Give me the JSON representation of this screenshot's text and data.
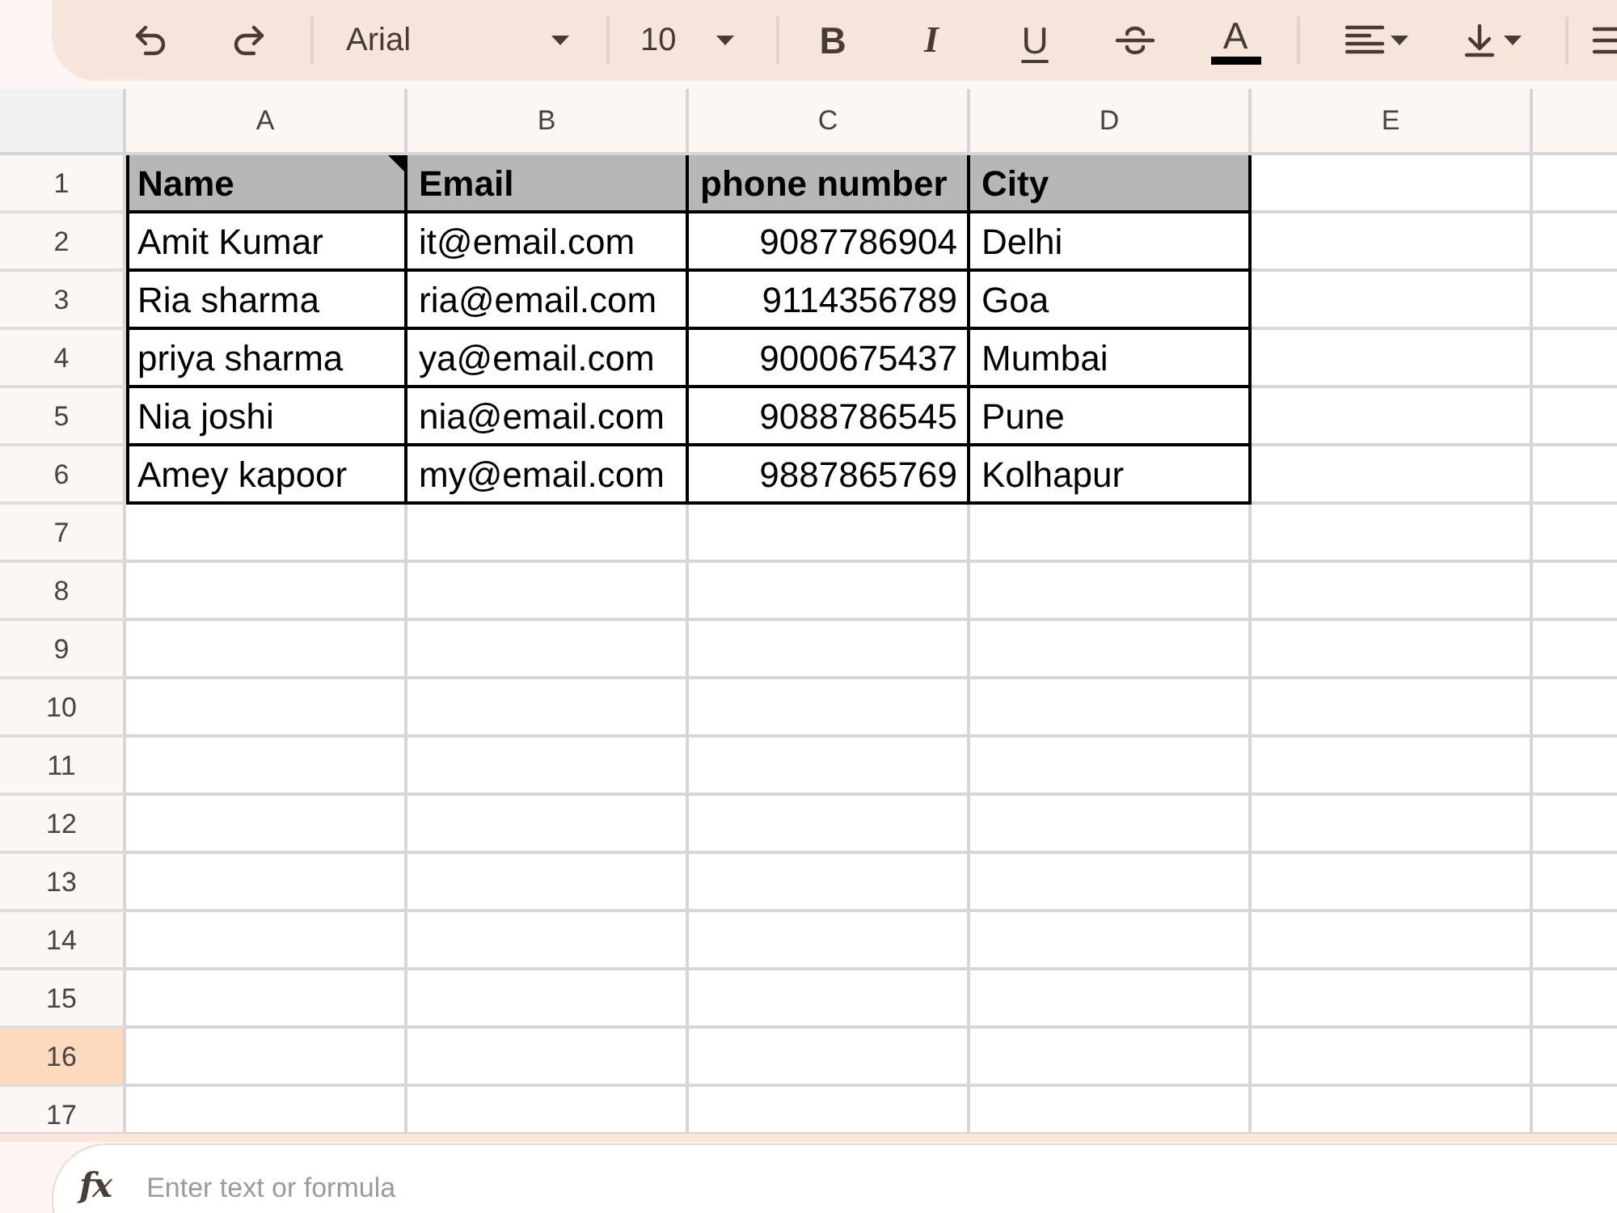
{
  "toolbar": {
    "font": "Arial",
    "font_size": "10",
    "format_buttons": [
      {
        "kind": "bold",
        "label": "B"
      },
      {
        "kind": "italic",
        "label": "I"
      },
      {
        "kind": "underline",
        "label": "U"
      },
      {
        "kind": "strikethrough"
      },
      {
        "kind": "text_color",
        "label": "A"
      }
    ]
  },
  "sheet": {
    "columns": [
      {
        "label": "A"
      },
      {
        "label": "B"
      },
      {
        "label": "C"
      },
      {
        "label": "D"
      },
      {
        "label": "E"
      }
    ],
    "row_headers": [
      {
        "label": "1",
        "selected": false
      },
      {
        "label": "2",
        "selected": false
      },
      {
        "label": "3",
        "selected": false
      },
      {
        "label": "4",
        "selected": false
      },
      {
        "label": "5",
        "selected": false
      },
      {
        "label": "6",
        "selected": false
      },
      {
        "label": "7",
        "selected": false
      },
      {
        "label": "8",
        "selected": false
      },
      {
        "label": "9",
        "selected": false
      },
      {
        "label": "10",
        "selected": false
      },
      {
        "label": "11",
        "selected": false
      },
      {
        "label": "12",
        "selected": false
      },
      {
        "label": "13",
        "selected": false
      },
      {
        "label": "14",
        "selected": false
      },
      {
        "label": "15",
        "selected": false
      },
      {
        "label": "16",
        "selected": true
      },
      {
        "label": "17",
        "selected": false
      }
    ],
    "header_row": [
      {
        "text": "Name",
        "note": true,
        "kind": "text"
      },
      {
        "text": "Email",
        "note": false,
        "kind": "text"
      },
      {
        "text": "phone number",
        "note": false,
        "kind": "number"
      },
      {
        "text": "City",
        "note": false,
        "kind": "text"
      }
    ],
    "data_rows": [
      [
        "Amit Kumar",
        "it@email.com",
        "9087786904",
        "Delhi"
      ],
      [
        "Ria sharma",
        "ria@email.com",
        "9114356789",
        "Goa"
      ],
      [
        "priya sharma",
        "ya@email.com",
        "9000675437",
        "Mumbai"
      ],
      [
        "Nia joshi",
        "nia@email.com",
        "9088786545",
        "Pune"
      ],
      [
        "Amey kapoor",
        "my@email.com",
        "9887865769",
        "Kolhapur"
      ]
    ]
  },
  "formula_bar": {
    "icon_label": "fx",
    "placeholder": "Enter text or formula"
  }
}
